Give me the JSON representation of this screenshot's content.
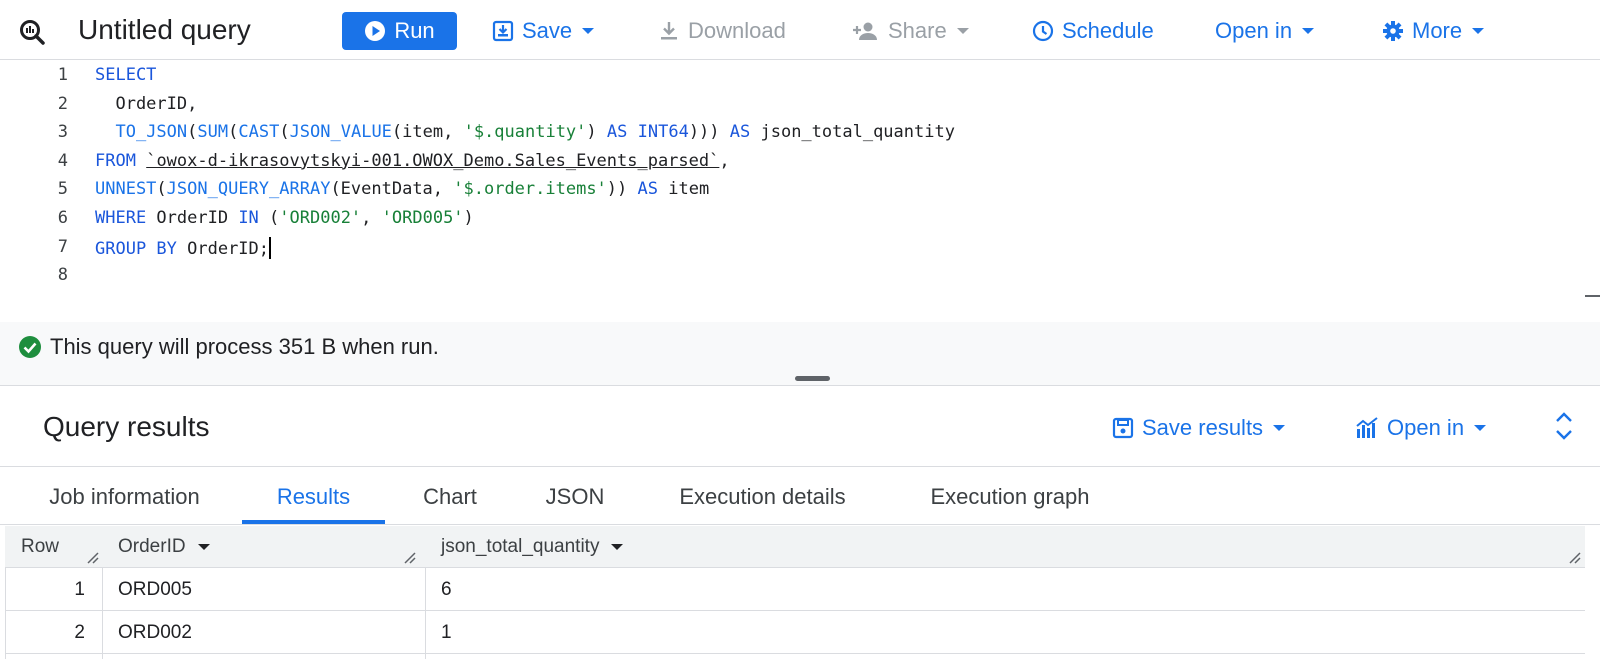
{
  "toolbar": {
    "title": "Untitled query",
    "run_label": "Run",
    "save_label": "Save",
    "download_label": "Download",
    "share_label": "Share",
    "schedule_label": "Schedule",
    "open_in_label": "Open in",
    "more_label": "More"
  },
  "editor": {
    "line_numbers": [
      "1",
      "2",
      "3",
      "4",
      "5",
      "6",
      "7",
      "8"
    ],
    "lines": [
      [
        {
          "t": "SELECT",
          "c": "kw"
        }
      ],
      [
        {
          "t": "  OrderID,",
          "c": ""
        }
      ],
      [
        {
          "t": "  ",
          "c": ""
        },
        {
          "t": "TO_JSON",
          "c": "fn"
        },
        {
          "t": "(",
          "c": ""
        },
        {
          "t": "SUM",
          "c": "fn"
        },
        {
          "t": "(",
          "c": ""
        },
        {
          "t": "CAST",
          "c": "fn"
        },
        {
          "t": "(",
          "c": ""
        },
        {
          "t": "JSON_VALUE",
          "c": "fn"
        },
        {
          "t": "(item, ",
          "c": ""
        },
        {
          "t": "'$.quantity'",
          "c": "str"
        },
        {
          "t": ") ",
          "c": ""
        },
        {
          "t": "AS",
          "c": "kw"
        },
        {
          "t": " ",
          "c": ""
        },
        {
          "t": "INT64",
          "c": "kw"
        },
        {
          "t": "))) ",
          "c": ""
        },
        {
          "t": "AS",
          "c": "kw"
        },
        {
          "t": " json_total_quantity",
          "c": ""
        }
      ],
      [
        {
          "t": "FROM",
          "c": "kw"
        },
        {
          "t": " ",
          "c": ""
        },
        {
          "t": "`owox-d-ikrasovytskyi-001.OWOX_Demo.Sales_Events_parsed`",
          "c": "tbl"
        },
        {
          "t": ",",
          "c": ""
        }
      ],
      [
        {
          "t": "UNNEST",
          "c": "fn"
        },
        {
          "t": "(",
          "c": ""
        },
        {
          "t": "JSON_QUERY_ARRAY",
          "c": "fn"
        },
        {
          "t": "(EventData, ",
          "c": ""
        },
        {
          "t": "'$.order.items'",
          "c": "str"
        },
        {
          "t": ")) ",
          "c": ""
        },
        {
          "t": "AS",
          "c": "kw"
        },
        {
          "t": " item",
          "c": ""
        }
      ],
      [
        {
          "t": "WHERE",
          "c": "kw"
        },
        {
          "t": " OrderID ",
          "c": ""
        },
        {
          "t": "IN",
          "c": "kw"
        },
        {
          "t": " (",
          "c": ""
        },
        {
          "t": "'ORD002'",
          "c": "str"
        },
        {
          "t": ", ",
          "c": ""
        },
        {
          "t": "'ORD005'",
          "c": "str"
        },
        {
          "t": ")",
          "c": ""
        }
      ],
      [
        {
          "t": "GROUP BY",
          "c": "kw"
        },
        {
          "t": " OrderID;",
          "c": ""
        }
      ],
      []
    ]
  },
  "validation": {
    "message": "This query will process 351 B when run."
  },
  "results": {
    "title": "Query results",
    "save_results_label": "Save results",
    "open_in_label": "Open in",
    "tabs": [
      {
        "label": "Job information"
      },
      {
        "label": "Results"
      },
      {
        "label": "Chart"
      },
      {
        "label": "JSON"
      },
      {
        "label": "Execution details"
      },
      {
        "label": "Execution graph"
      }
    ],
    "columns": [
      "Row",
      "OrderID",
      "json_total_quantity"
    ],
    "rows": [
      {
        "row": "1",
        "order_id": "ORD005",
        "total": "6"
      },
      {
        "row": "2",
        "order_id": "ORD002",
        "total": "1"
      }
    ]
  },
  "colors": {
    "accent": "#1a73e8",
    "success": "#1e8e3e"
  }
}
